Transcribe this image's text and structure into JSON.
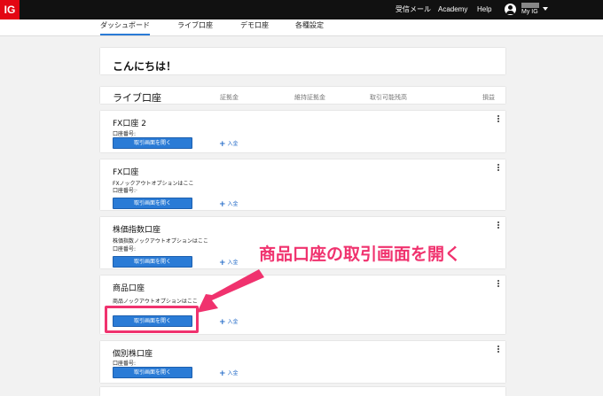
{
  "topbar": {
    "logo": "IG",
    "links": [
      "受信メール",
      "Academy",
      "Help"
    ],
    "user_name": "My IG"
  },
  "nav": {
    "tabs": [
      "ダッシュボード",
      "ライブ口座",
      "デモ口座",
      "各種設定"
    ],
    "active_index": 0
  },
  "greeting": "こんにちは！",
  "live_section": {
    "title": "ライブ口座",
    "columns": [
      "証拠金",
      "維持証拠金",
      "取引可能残高",
      "損益"
    ]
  },
  "accounts": [
    {
      "name": "FX口座 2",
      "sub": "",
      "number_label": "口座番号:",
      "button": "取引画面を開く",
      "deposit": "入金"
    },
    {
      "name": "FX口座",
      "sub": "FXノックアウトオプションはここ",
      "number_label": "口座番号:·",
      "button": "取引画面を開く",
      "deposit": "入金"
    },
    {
      "name": "株価指数口座",
      "sub": "株価指数ノックアウトオプションはここ",
      "number_label": "口座番号:",
      "button": "取引画面を開く",
      "deposit": "入金"
    },
    {
      "name": "商品口座",
      "sub": "商品ノックアウトオプションはここ",
      "number_label": "",
      "button": "取引画面を開く",
      "deposit": "入金"
    },
    {
      "name": "個別株口座",
      "sub": "",
      "number_label": "口座番号:",
      "button": "取引画面を開く",
      "deposit": "入金"
    }
  ],
  "annotation": {
    "text": "商品口座の取引画面を開く",
    "color": "#f0326e"
  },
  "colors": {
    "brand": "#e30613",
    "accent": "#2a7bd6",
    "highlight": "#f0326e"
  }
}
